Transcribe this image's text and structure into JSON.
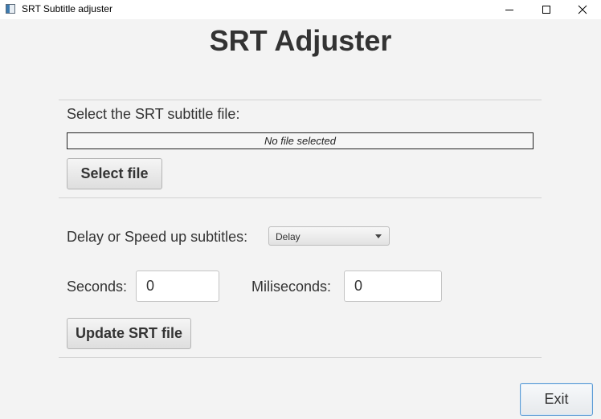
{
  "window": {
    "title": "SRT Subtitle adjuster",
    "controls": [
      "minimize-icon",
      "maximize-icon",
      "close-icon"
    ]
  },
  "main": {
    "heading": "SRT Adjuster",
    "file_section": {
      "label": "Select the SRT subtitle file:",
      "file_status": "No file selected",
      "select_button": "Select file"
    },
    "adjust_section": {
      "mode_label": "Delay or Speed up subtitles:",
      "mode_selected": "Delay",
      "seconds_label": "Seconds:",
      "seconds_value": "0",
      "milliseconds_label": "Miliseconds:",
      "milliseconds_value": "0",
      "update_button": "Update SRT file"
    },
    "exit_button": "Exit"
  },
  "colors": {
    "background": "#f3f3f3",
    "text": "#333333",
    "focus_border": "#5b9bd5"
  }
}
